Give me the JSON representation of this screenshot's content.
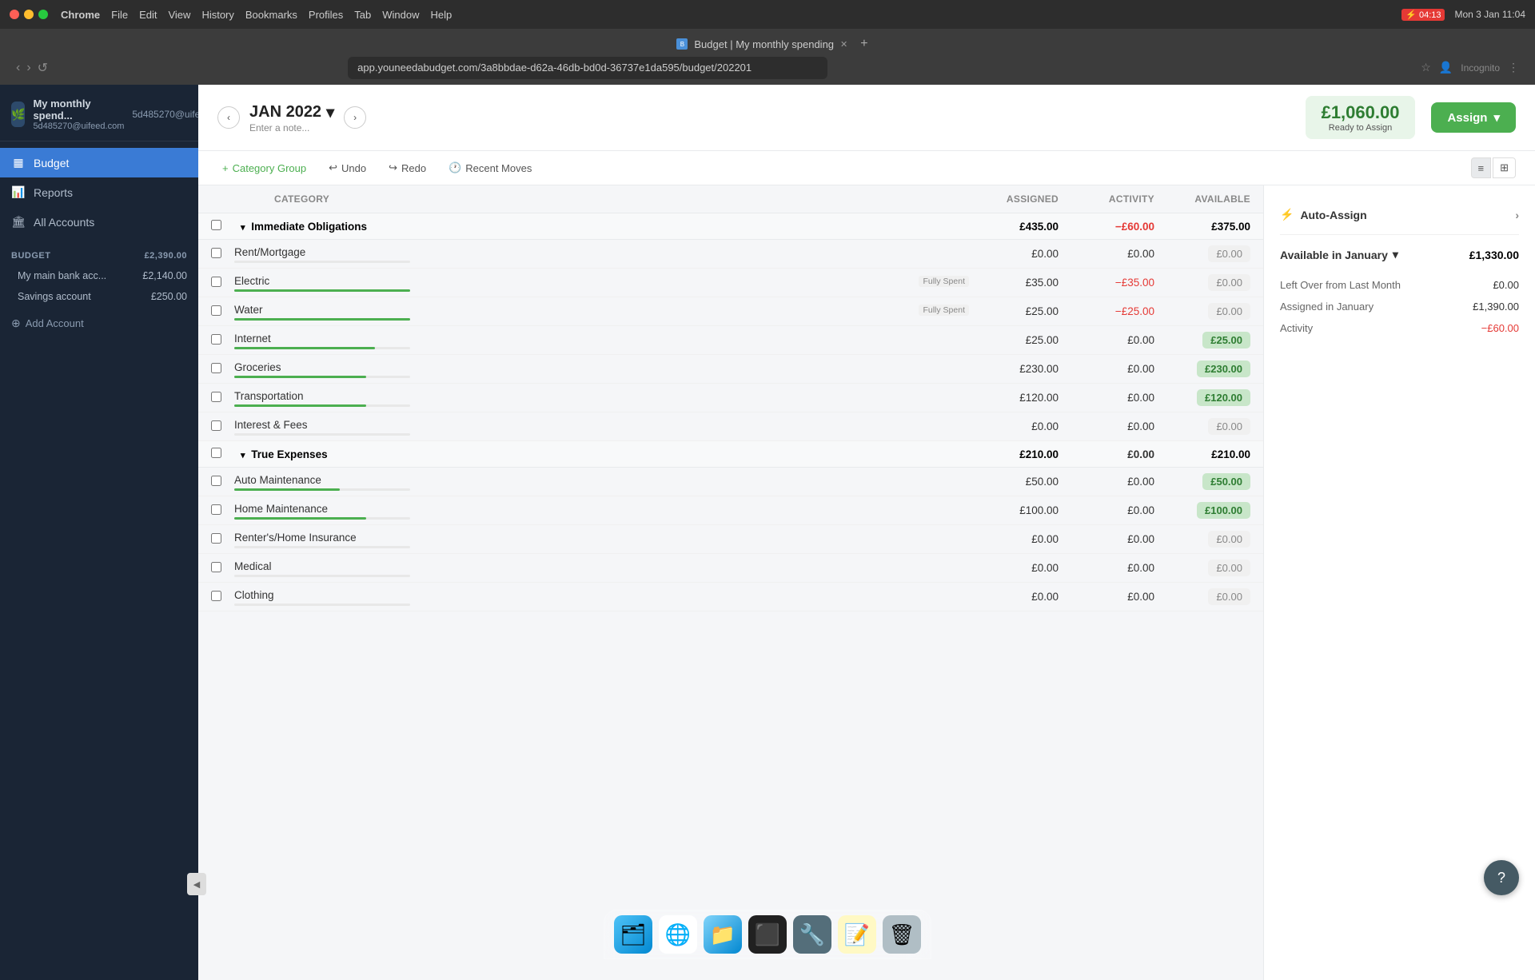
{
  "titlebar": {
    "browser": "Chrome",
    "menu_items": [
      "Chrome",
      "File",
      "Edit",
      "View",
      "History",
      "Bookmarks",
      "Profiles",
      "Tab",
      "Window",
      "Help"
    ],
    "time": "04:13",
    "date": "Mon 3 Jan  11:04",
    "tab_title": "Budget | My monthly spending",
    "tab_favicon": "B",
    "url": "app.youneedabudget.com/3a8bbdae-d62a-46db-bd0d-36737e1da595/budget/202201",
    "profile": "Incognito"
  },
  "sidebar": {
    "logo_text": "🌿",
    "app_name": "My monthly spend...",
    "app_subtitle": "5d485270@uifeed.com",
    "nav_items": [
      {
        "id": "budget",
        "label": "Budget",
        "icon": "▦",
        "active": true
      },
      {
        "id": "reports",
        "label": "Reports",
        "icon": "📊"
      },
      {
        "id": "all-accounts",
        "label": "All Accounts",
        "icon": "🏛"
      }
    ],
    "section_label": "BUDGET",
    "section_amount": "£2,390.00",
    "accounts": [
      {
        "id": "main-bank",
        "name": "My main bank acc...",
        "amount": "£2,140.00"
      },
      {
        "id": "savings",
        "name": "Savings account",
        "amount": "£250.00"
      }
    ],
    "add_account_label": "Add Account",
    "collapse_icon": "◀"
  },
  "budget_header": {
    "prev_icon": "‹",
    "next_icon": "›",
    "month": "JAN 2022",
    "month_chevron": "▾",
    "note_placeholder": "Enter a note...",
    "ready_amount": "£1,060.00",
    "ready_label": "Ready to Assign",
    "assign_label": "Assign",
    "assign_chevron": "▾"
  },
  "toolbar": {
    "add_group_label": "Category Group",
    "add_group_icon": "+",
    "undo_label": "Undo",
    "undo_icon": "↩",
    "redo_label": "Redo",
    "redo_icon": "↪",
    "recent_moves_label": "Recent Moves",
    "recent_moves_icon": "🕐",
    "view_list_icon": "≡",
    "view_grid_icon": "⊞"
  },
  "table": {
    "headers": [
      "",
      "CATEGORY",
      "ASSIGNED",
      "ACTIVITY",
      "AVAILABLE"
    ],
    "groups": [
      {
        "id": "immediate-obligations",
        "name": "Immediate Obligations",
        "assigned": "£435.00",
        "activity": "−£60.00",
        "available": "£375.00",
        "available_type": "plain",
        "categories": [
          {
            "id": "rent",
            "name": "Rent/Mortgage",
            "assigned": "£0.00",
            "activity": "£0.00",
            "available": "£0.00",
            "available_type": "gray",
            "progress": 0,
            "badge": ""
          },
          {
            "id": "electric",
            "name": "Electric",
            "assigned": "£35.00",
            "activity": "−£35.00",
            "available": "£0.00",
            "available_type": "gray",
            "progress": 100,
            "badge": "Fully Spent"
          },
          {
            "id": "water",
            "name": "Water",
            "assigned": "£25.00",
            "activity": "−£25.00",
            "available": "£0.00",
            "available_type": "gray",
            "progress": 100,
            "badge": "Fully Spent"
          },
          {
            "id": "internet",
            "name": "Internet",
            "assigned": "£25.00",
            "activity": "£0.00",
            "available": "£25.00",
            "available_type": "green",
            "progress": 80,
            "badge": ""
          },
          {
            "id": "groceries",
            "name": "Groceries",
            "assigned": "£230.00",
            "activity": "£0.00",
            "available": "£230.00",
            "available_type": "green",
            "progress": 75,
            "badge": ""
          },
          {
            "id": "transportation",
            "name": "Transportation",
            "assigned": "£120.00",
            "activity": "£0.00",
            "available": "£120.00",
            "available_type": "green",
            "progress": 75,
            "badge": ""
          },
          {
            "id": "interest-fees",
            "name": "Interest & Fees",
            "assigned": "£0.00",
            "activity": "£0.00",
            "available": "£0.00",
            "available_type": "gray",
            "progress": 0,
            "badge": ""
          }
        ]
      },
      {
        "id": "true-expenses",
        "name": "True Expenses",
        "assigned": "£210.00",
        "activity": "£0.00",
        "available": "£210.00",
        "available_type": "plain",
        "categories": [
          {
            "id": "auto-maintenance",
            "name": "Auto Maintenance",
            "assigned": "£50.00",
            "activity": "£0.00",
            "available": "£50.00",
            "available_type": "green",
            "progress": 60,
            "badge": ""
          },
          {
            "id": "home-maintenance",
            "name": "Home Maintenance",
            "assigned": "£100.00",
            "activity": "£0.00",
            "available": "£100.00",
            "available_type": "green",
            "progress": 75,
            "badge": ""
          },
          {
            "id": "renters-insurance",
            "name": "Renter's/Home Insurance",
            "assigned": "£0.00",
            "activity": "£0.00",
            "available": "£0.00",
            "available_type": "gray",
            "progress": 0,
            "badge": ""
          },
          {
            "id": "medical",
            "name": "Medical",
            "assigned": "£0.00",
            "activity": "£0.00",
            "available": "£0.00",
            "available_type": "gray",
            "progress": 0,
            "badge": ""
          },
          {
            "id": "clothing",
            "name": "Clothing",
            "assigned": "£0.00",
            "activity": "£0.00",
            "available": "£0.00",
            "available_type": "gray",
            "progress": 0,
            "badge": ""
          }
        ]
      }
    ]
  },
  "right_panel": {
    "auto_assign_label": "Auto-Assign",
    "auto_assign_icon": "⚡",
    "auto_assign_chevron": "›",
    "available_section_title": "Available in January",
    "available_section_chevron": "▾",
    "available_total": "£1,330.00",
    "stats": [
      {
        "label": "Left Over from Last Month",
        "value": "£0.00",
        "type": "normal"
      },
      {
        "label": "Assigned in January",
        "value": "£1,390.00",
        "type": "normal"
      },
      {
        "label": "Activity",
        "value": "−£60.00",
        "type": "negative"
      }
    ]
  },
  "help_btn": "?",
  "dock": {
    "icons": [
      "🗂",
      "🌐",
      "📁",
      "⬛",
      "🔧",
      "📝",
      "🗑"
    ]
  }
}
